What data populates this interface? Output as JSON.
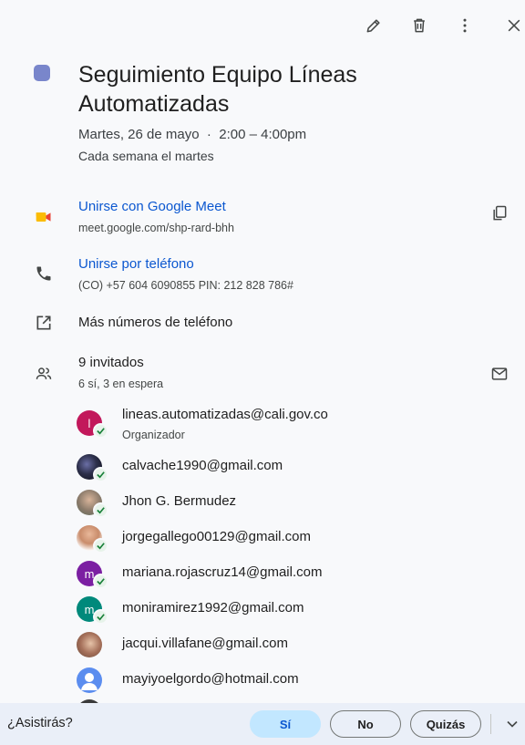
{
  "toolbar": {
    "edit_icon": "pencil-icon",
    "delete_icon": "trash-icon",
    "more_icon": "more-vert-icon",
    "close_icon": "close-icon"
  },
  "event": {
    "color": "#7986cb",
    "title": "Seguimiento Equipo Líneas Automatizadas",
    "when": "Martes, 26 de mayo  ·  2:00 – 4:00pm",
    "recurrence": "Cada semana el martes"
  },
  "meet": {
    "label": "Unirse con Google Meet",
    "url": "meet.google.com/shp-rard-bhh"
  },
  "phone": {
    "label": "Unirse por teléfono",
    "detail": "(CO) +57 604 6090855 PIN: 212 828 786#"
  },
  "more_numbers": "Más números de teléfono",
  "guests": {
    "count": "9 invitados",
    "summary": "6 sí, 3 en espera",
    "list": [
      {
        "name": "lineas.automatizadas@cali.gov.co",
        "role": "Organizador",
        "initial": "l",
        "color": "#c2185b"
      },
      {
        "name": "calvache1990@gmail.com"
      },
      {
        "name": "Jhon G. Bermudez"
      },
      {
        "name": "jorgegallego00129@gmail.com"
      },
      {
        "name": "mariana.rojascruz14@gmail.com",
        "initial": "m",
        "color": "#7b1fa2"
      },
      {
        "name": "moniramirez1992@gmail.com",
        "initial": "m",
        "color": "#00897b"
      },
      {
        "name": "jacqui.villafane@gmail.com"
      },
      {
        "name": "mayiyoelgordo@hotmail.com"
      }
    ]
  },
  "rsvp": {
    "question": "¿Asistirás?",
    "yes": "Sí",
    "no": "No",
    "maybe": "Quizás"
  }
}
